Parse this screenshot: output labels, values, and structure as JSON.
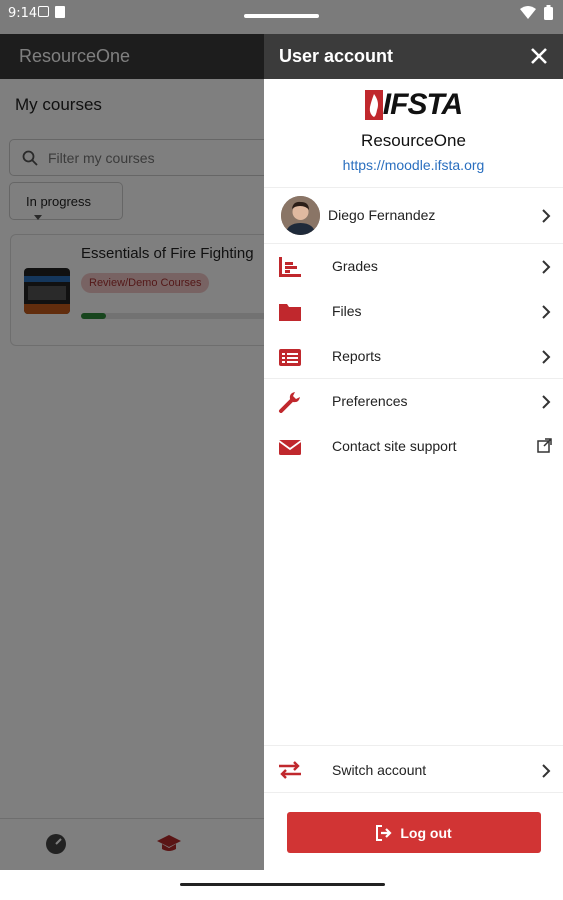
{
  "status_bar": {
    "time": "9:14"
  },
  "background": {
    "app_title": "ResourceOne",
    "section_title": "My courses",
    "search_placeholder": "Filter my courses",
    "filter_label": "In progress",
    "course": {
      "title": "Essentials of Fire Fighting",
      "badge": "Review/Demo Courses",
      "progress": 0.05
    }
  },
  "drawer": {
    "title": "User account",
    "logo_text": "IFSTA",
    "site_name": "ResourceOne",
    "site_url": "https://moodle.ifsta.org",
    "user_name": "Diego Fernandez",
    "menu": [
      {
        "label": "Grades",
        "icon": "grades-icon"
      },
      {
        "label": "Files",
        "icon": "folder-icon"
      },
      {
        "label": "Reports",
        "icon": "reports-icon"
      },
      {
        "label": "Preferences",
        "icon": "wrench-icon"
      },
      {
        "label": "Contact site support",
        "icon": "envelope-icon"
      }
    ],
    "switch_account": "Switch account",
    "logout": "Log out"
  },
  "colors": {
    "accent": "#d13434",
    "header": "#3b3b3b",
    "link": "#2a6fbf"
  }
}
